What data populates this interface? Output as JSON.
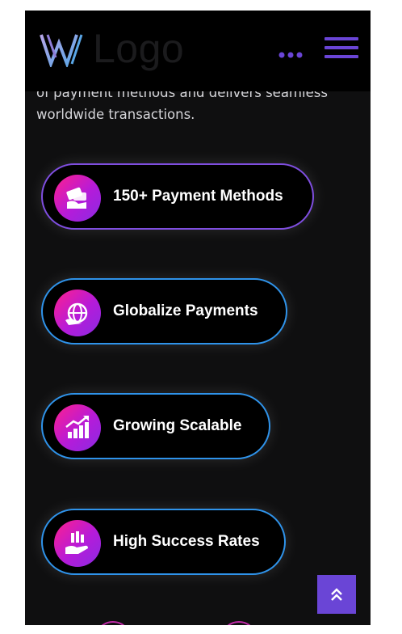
{
  "header": {
    "logo_text": "Logo",
    "logo_icon": "w-logo-icon",
    "more_icon": "more-dots-icon",
    "menu_icon": "hamburger-menu-icon",
    "accent_color": "#6a45d6"
  },
  "intro": {
    "text_line1": "of payment methods and delivers seamless",
    "text_line2": "worldwide transactions."
  },
  "features": [
    {
      "label": "150+ Payment Methods",
      "icon": "payment-methods-icon"
    },
    {
      "label": "Globalize Payments",
      "icon": "globe-payment-icon"
    },
    {
      "label": "Growing Scalable",
      "icon": "growth-chart-icon"
    },
    {
      "label": "High Success Rates",
      "icon": "success-hand-icon"
    }
  ],
  "colors": {
    "background": "#0f0f10",
    "pill_border_primary": "#7f4ee0",
    "pill_border": "#2f93ea",
    "icon_gradient_start": "#ff1f8e",
    "icon_gradient_end": "#8a2be2"
  },
  "scroll_top_icon": "double-chevron-up-icon"
}
